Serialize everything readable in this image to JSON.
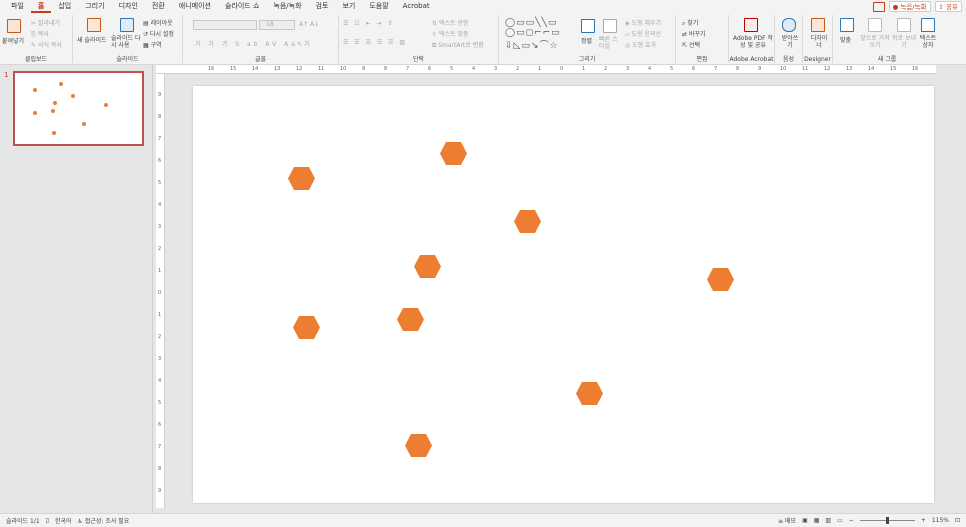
{
  "menu": {
    "tabs": [
      "파일",
      "홈",
      "삽입",
      "그리기",
      "디자인",
      "전환",
      "애니메이션",
      "슬라이드 쇼",
      "녹음/녹화",
      "검토",
      "보기",
      "도움말",
      "Acrobat"
    ],
    "active_tab": "홈",
    "record_label": "녹음/녹화",
    "share_label": "공유"
  },
  "ribbon": {
    "clipboard": {
      "paste": "붙여넣기",
      "cut": "잘라내기",
      "copy": "복사",
      "format_painter": "서식 복사",
      "label": "클립보드"
    },
    "slides": {
      "new_slide": "새 슬라이드",
      "reuse": "슬라이드 다시 사용",
      "layout": "레이아웃",
      "reset": "다시 설정",
      "section": "구역",
      "label": "슬라이드"
    },
    "font": {
      "size": "18",
      "label": "글꼴"
    },
    "paragraph": {
      "text_direction": "텍스트 방향",
      "align_text": "텍스트 맞춤",
      "smartart": "SmartArt로 변환",
      "label": "단락"
    },
    "drawing": {
      "arrange": "정렬",
      "quick_styles": "빠른 스타일",
      "fill": "도형 채우기",
      "outline": "도형 윤곽선",
      "effects": "도형 효과",
      "label": "그리기"
    },
    "editing": {
      "find": "찾기",
      "replace": "바꾸기",
      "select": "선택",
      "label": "편집"
    },
    "acrobat": {
      "create_pdf": "Adobe PDF 작성 및 공유",
      "label": "Adobe Acrobat"
    },
    "voice": {
      "dictate": "받아쓰기",
      "label": "음성"
    },
    "designer": {
      "designer": "디자이너",
      "label": "Designer"
    },
    "new_group": {
      "fit": "맞춤",
      "import": "앞으로 가져오기",
      "send_back": "뒤로 보내기",
      "textbox": "텍스트 상자",
      "label": "새 그룹"
    }
  },
  "ruler": {
    "h_ticks": [
      "16",
      "15",
      "14",
      "13",
      "12",
      "11",
      "10",
      "9",
      "8",
      "7",
      "6",
      "5",
      "4",
      "3",
      "2",
      "1",
      "0",
      "1",
      "2",
      "3",
      "4",
      "5",
      "6",
      "7",
      "8",
      "9",
      "10",
      "11",
      "12",
      "13",
      "14",
      "15",
      "16"
    ],
    "v_ticks": [
      "9",
      "8",
      "7",
      "6",
      "5",
      "4",
      "3",
      "2",
      "1",
      "0",
      "1",
      "2",
      "3",
      "4",
      "5",
      "6",
      "7",
      "8",
      "9"
    ]
  },
  "thumbnail": {
    "number": "1"
  },
  "slide": {
    "shape_color": "#ED7D31"
  },
  "status": {
    "slide_count": "슬라이드 1/1",
    "language": "한국어",
    "accessibility": "접근성: 조사 필요",
    "notes": "메모",
    "zoom": "115%"
  }
}
